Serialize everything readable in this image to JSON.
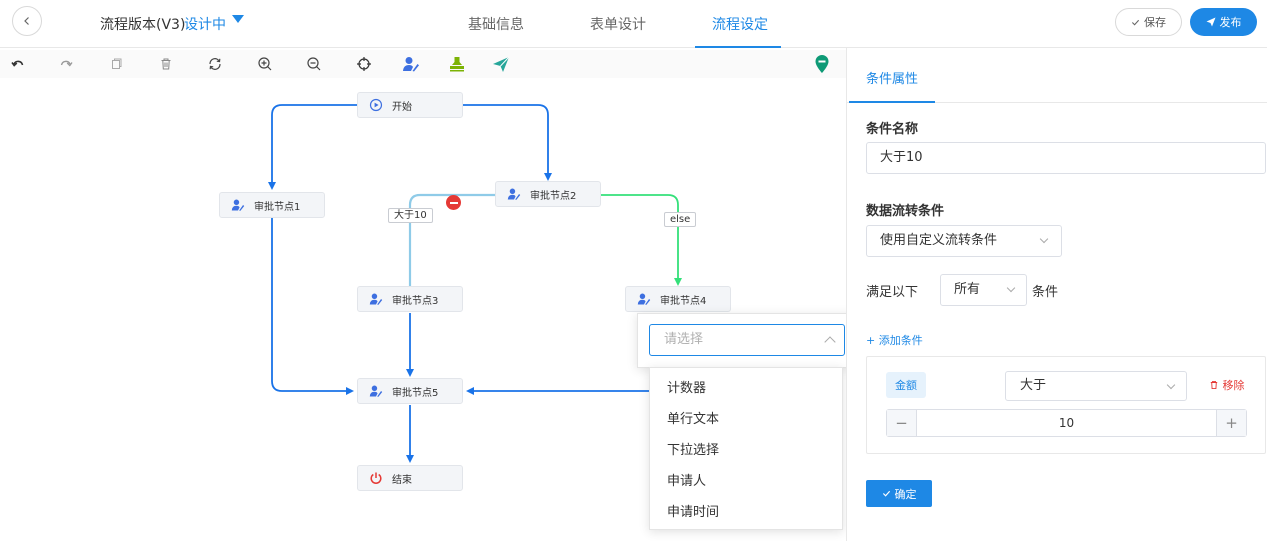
{
  "header": {
    "back_icon": "chevron-left-icon",
    "title": "流程版本(V3)",
    "status": "设计中",
    "tabs": [
      {
        "label": "基础信息",
        "active": false
      },
      {
        "label": "表单设计",
        "active": false
      },
      {
        "label": "流程设定",
        "active": true
      }
    ],
    "save_label": "保存",
    "publish_label": "发布"
  },
  "toolbar": {
    "tools": [
      "undo-icon",
      "redo-icon",
      "copy-icon",
      "delete-icon",
      "refresh-icon",
      "zoom-in-icon",
      "zoom-out-icon",
      "locate-icon",
      "approver-icon",
      "stamp-icon",
      "send-icon",
      "map-pin-icon"
    ]
  },
  "flow": {
    "nodes": {
      "start": "开始",
      "n1": "审批节点1",
      "n2": "审批节点2",
      "n3": "审批节点3",
      "n4": "审批节点4",
      "n5": "审批节点5",
      "end": "结束"
    },
    "edge_labels": {
      "gt10": "大于10",
      "else": "else"
    }
  },
  "field_dropdown": {
    "placeholder": "请选择",
    "options": [
      "计数器",
      "单行文本",
      "下拉选择",
      "申请人",
      "申请时间"
    ]
  },
  "panel": {
    "tab": "条件属性",
    "name_label": "条件名称",
    "name_value": "大于10",
    "flow_cond_label": "数据流转条件",
    "flow_cond_value": "使用自定义流转条件",
    "satisfy_prefix": "满足以下",
    "satisfy_value": "所有",
    "satisfy_suffix": "条件",
    "add_condition": "+ 添加条件",
    "condition": {
      "field": "金额",
      "operator": "大于",
      "remove_label": "移除",
      "value": "10"
    },
    "confirm_label": "确定"
  },
  "colors": {
    "accent": "#1e88e5",
    "danger": "#e53935",
    "edge_blue": "#1a73e8",
    "edge_lightblue": "#8fcbe8",
    "edge_green": "#34e07a"
  }
}
